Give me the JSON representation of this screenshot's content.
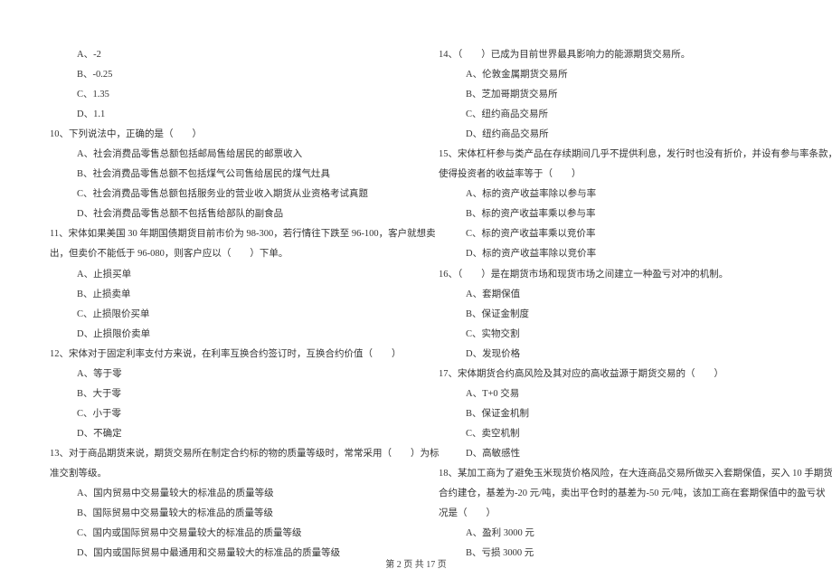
{
  "left_column": {
    "pre_options": [
      "A、-2",
      "B、-0.25",
      "C、1.35",
      "D、1.1"
    ],
    "q10": {
      "stem": "10、下列说法中，正确的是（　　）",
      "options": [
        "A、社会消费品零售总额包括邮局售给居民的邮票收入",
        "B、社会消费品零售总额不包括煤气公司售给居民的煤气灶具",
        "C、社会消费品零售总额包括服务业的营业收入期货从业资格考试真题",
        "D、社会消费品零售总额不包括售给部队的副食品"
      ]
    },
    "q11": {
      "stem_l1": "11、宋体如果美国 30 年期国债期货目前市价为 98-300，若行情往下跌至 96-100，客户就想卖",
      "stem_l2": "出，但卖价不能低于 96-080，则客户应以（　　）下单。",
      "options": [
        "A、止损买单",
        "B、止损卖单",
        "C、止损限价买单",
        "D、止损限价卖单"
      ]
    },
    "q12": {
      "stem": "12、宋体对于固定利率支付方来说，在利率互换合约签订时，互换合约价值（　　）",
      "options": [
        "A、等于零",
        "B、大于零",
        "C、小于零",
        "D、不确定"
      ]
    },
    "q13": {
      "stem_l1": "13、对于商品期货来说，期货交易所在制定合约标的物的质量等级时，常常采用（　　）为标",
      "stem_l2": "准交割等级。",
      "options": [
        "A、国内贸易中交易量较大的标准品的质量等级",
        "B、国际贸易中交易量较大的标准品的质量等级",
        "C、国内或国际贸易中交易量较大的标准品的质量等级",
        "D、国内或国际贸易中最通用和交易量较大的标准品的质量等级"
      ]
    }
  },
  "right_column": {
    "q14": {
      "stem": "14、（　　）已成为目前世界最具影响力的能源期货交易所。",
      "options": [
        "A、伦敦金属期货交易所",
        "B、芝加哥期货交易所",
        "C、纽约商品交易所",
        "D、纽约商品交易所"
      ]
    },
    "q15": {
      "stem_l1": "15、宋体杠杆参与类产品在存续期间几乎不提供利息，发行时也没有折价，并设有参与率条款，",
      "stem_l2": "使得投资者的收益率等于（　　）",
      "options": [
        "A、标的资产收益率除以参与率",
        "B、标的资产收益率乘以参与率",
        "C、标的资产收益率乘以竞价率",
        "D、标的资产收益率除以竞价率"
      ]
    },
    "q16": {
      "stem": "16、（　　）是在期货市场和现货市场之间建立一种盈亏对冲的机制。",
      "options": [
        "A、套期保值",
        "B、保证金制度",
        "C、实物交割",
        "D、发现价格"
      ]
    },
    "q17": {
      "stem": "17、宋体期货合约高风险及其对应的高收益源于期货交易的（　　）",
      "options": [
        "A、T+0 交易",
        "B、保证金机制",
        "C、卖空机制",
        "D、高敏感性"
      ]
    },
    "q18": {
      "stem_l1": "18、某加工商为了避免玉米现货价格风险，在大连商品交易所做买入套期保值，买入 10 手期货",
      "stem_l2": "合约建仓，基差为-20 元/吨，卖出平仓时的基差为-50 元/吨，该加工商在套期保值中的盈亏状",
      "stem_l3": "况是（　　）",
      "options": [
        "A、盈利 3000 元",
        "B、亏损 3000 元"
      ]
    }
  },
  "footer": "第 2 页 共 17 页"
}
